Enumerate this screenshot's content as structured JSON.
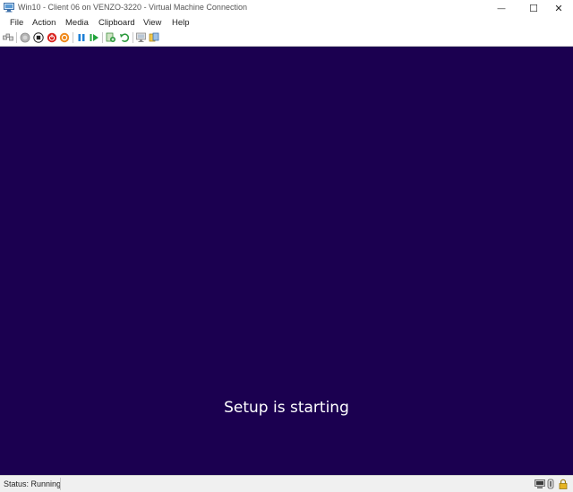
{
  "window": {
    "title": "Win10 - Client 06 on VENZO-3220 - Virtual Machine Connection",
    "minimize_glyph": "—",
    "maximize_glyph": "☐",
    "close_glyph": "✕"
  },
  "menu": {
    "items": [
      {
        "label": "File"
      },
      {
        "label": "Action"
      },
      {
        "label": "Media"
      },
      {
        "label": "Clipboard"
      },
      {
        "label": "View"
      },
      {
        "label": "Help"
      }
    ]
  },
  "toolbar": {
    "buttons": [
      {
        "icon": "ctrl-alt-del-icon"
      },
      {
        "icon": "start-icon"
      },
      {
        "icon": "turn-off-icon"
      },
      {
        "icon": "shut-down-icon"
      },
      {
        "icon": "save-icon"
      },
      {
        "icon": "pause-icon"
      },
      {
        "icon": "resume-icon"
      },
      {
        "icon": "checkpoint-icon"
      },
      {
        "icon": "revert-icon"
      },
      {
        "icon": "enhanced-session-icon"
      },
      {
        "icon": "share-icon"
      }
    ]
  },
  "vm_screen": {
    "message": "Setup is starting",
    "background_color": "#1b0050"
  },
  "status_bar": {
    "status": "Status: Running",
    "icons": [
      "screen-icon",
      "audio-icon",
      "lock-icon"
    ]
  }
}
